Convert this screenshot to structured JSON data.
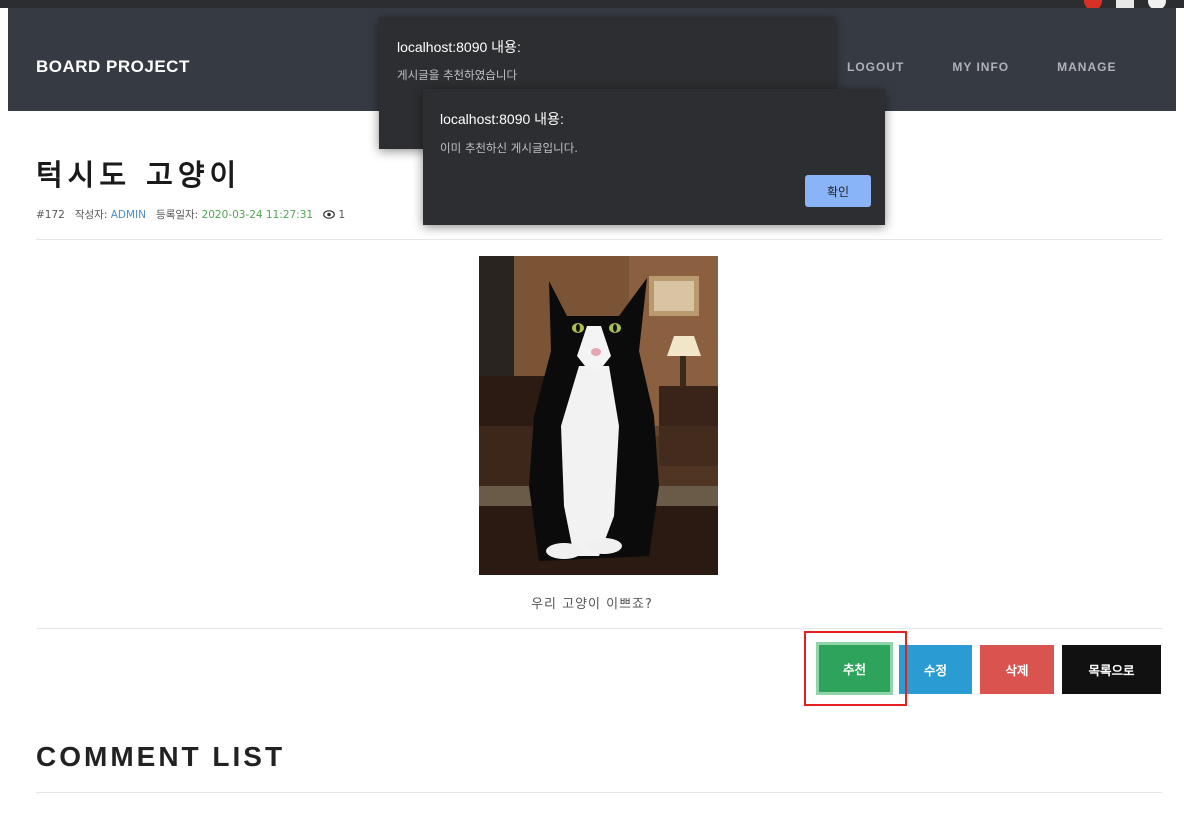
{
  "navbar": {
    "brand": "BOARD PROJECT",
    "links": [
      "LOGOUT",
      "MY INFO",
      "MANAGE"
    ]
  },
  "post": {
    "title": "턱시도 고양이",
    "number": "#172",
    "author_label": "작성자:",
    "author": "ADMIN",
    "date_label": "등록일자:",
    "date": "2020-03-24 11:27:31",
    "views": "1",
    "caption": "우리 고양이 이쁘죠?"
  },
  "actions": {
    "recommend": "추천",
    "edit": "수정",
    "delete": "삭제",
    "list": "목록으로"
  },
  "comments": {
    "title": "COMMENT LIST"
  },
  "dialogs": [
    {
      "title": "localhost:8090 내용:",
      "message": "게시글을 추천하였습니다"
    },
    {
      "title": "localhost:8090 내용:",
      "message": "이미 추천하신 게시글입니다.",
      "ok_label": "확인"
    }
  ],
  "icons": {
    "views": "eye-icon"
  },
  "colors": {
    "navbar": "#363a42",
    "recommend": "#2ea35b",
    "edit": "#2b9cd3",
    "delete": "#d9534f",
    "list": "#111111",
    "dialog_ok": "#8ab4f8",
    "highlight": "#e52020"
  }
}
